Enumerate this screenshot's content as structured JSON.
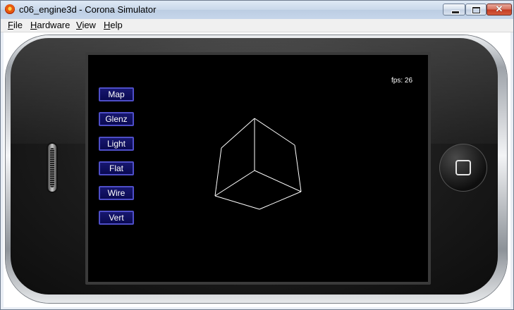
{
  "window": {
    "title": "c06_engine3d - Corona Simulator",
    "close_glyph": "✕"
  },
  "menu": {
    "items": [
      "File",
      "Hardware",
      "View",
      "Help"
    ]
  },
  "screen": {
    "fps_text": "fps: 26",
    "buttons": [
      "Map",
      "Glenz",
      "Light",
      "Flat",
      "Wire",
      "Vert"
    ]
  },
  "colors": {
    "button_fill": "#11116a",
    "button_border": "#4e4ec8",
    "wireframe": "#ffffff"
  },
  "icons": {
    "app": "corona-app-icon",
    "minimize": "minimize-icon",
    "maximize": "maximize-icon",
    "close": "close-icon",
    "home": "home-button-icon",
    "speaker": "speaker-grille"
  }
}
